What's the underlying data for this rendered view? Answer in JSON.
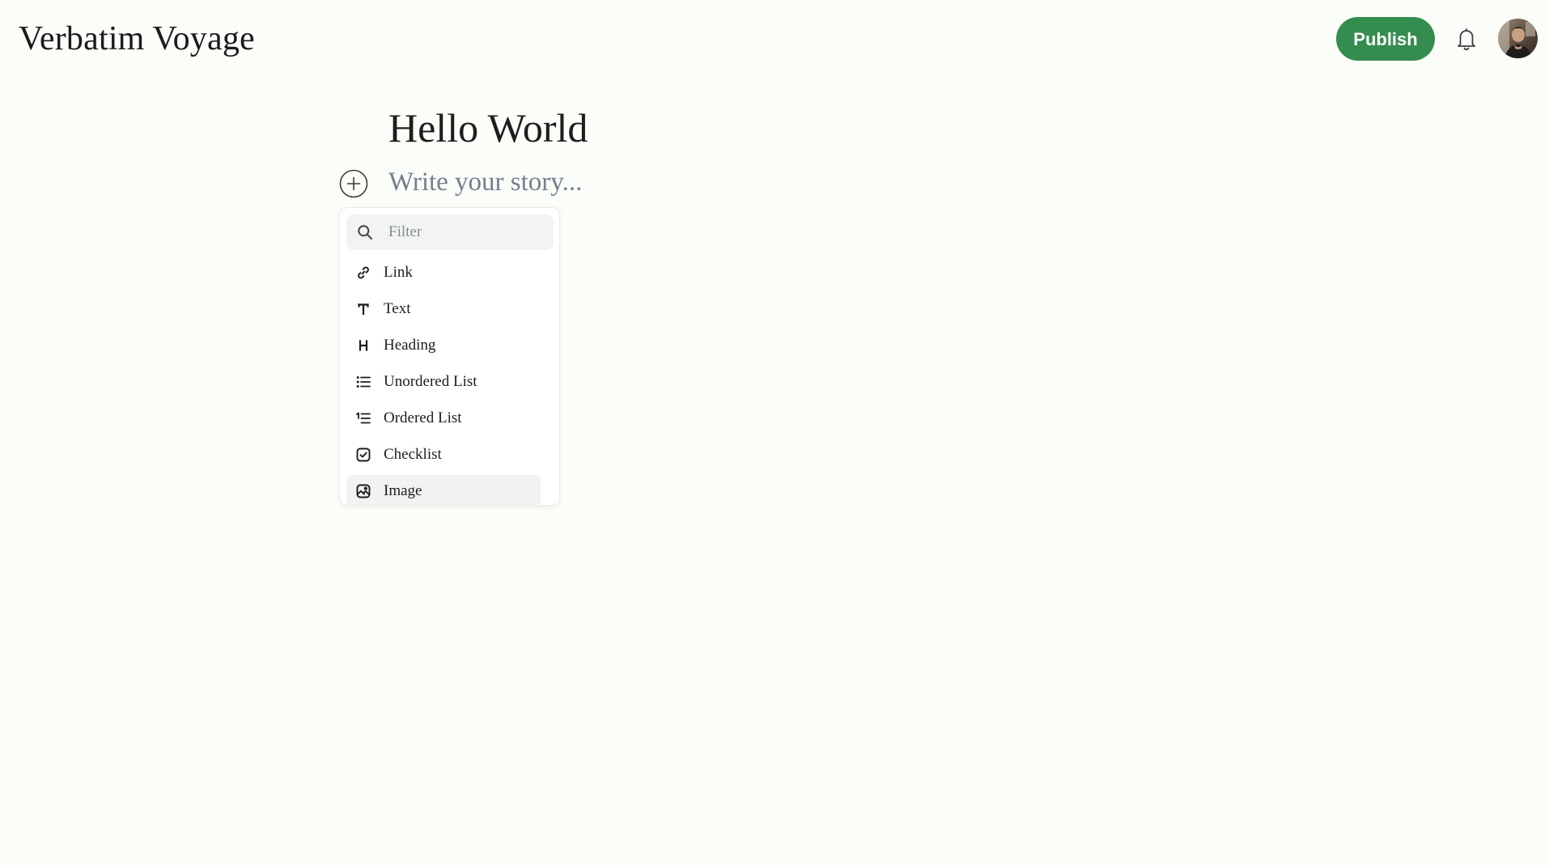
{
  "header": {
    "brand": "Verbatim Voyage",
    "publish_label": "Publish",
    "brand_color": "#358c4f"
  },
  "icons": {
    "notifications": "bell-icon",
    "avatar": "user-avatar",
    "add_block": "plus-circle-icon",
    "filter": "search-icon"
  },
  "editor": {
    "title": "Hello World",
    "story_placeholder": "Write your story..."
  },
  "block_menu": {
    "filter_placeholder": "Filter",
    "items": [
      {
        "label": "Link",
        "icon": "link-icon"
      },
      {
        "label": "Text",
        "icon": "text-icon"
      },
      {
        "label": "Heading",
        "icon": "heading-icon"
      },
      {
        "label": "Unordered List",
        "icon": "unordered-list-icon"
      },
      {
        "label": "Ordered List",
        "icon": "ordered-list-icon"
      },
      {
        "label": "Checklist",
        "icon": "checklist-icon"
      },
      {
        "label": "Image",
        "icon": "image-icon",
        "highlighted": true
      }
    ]
  }
}
